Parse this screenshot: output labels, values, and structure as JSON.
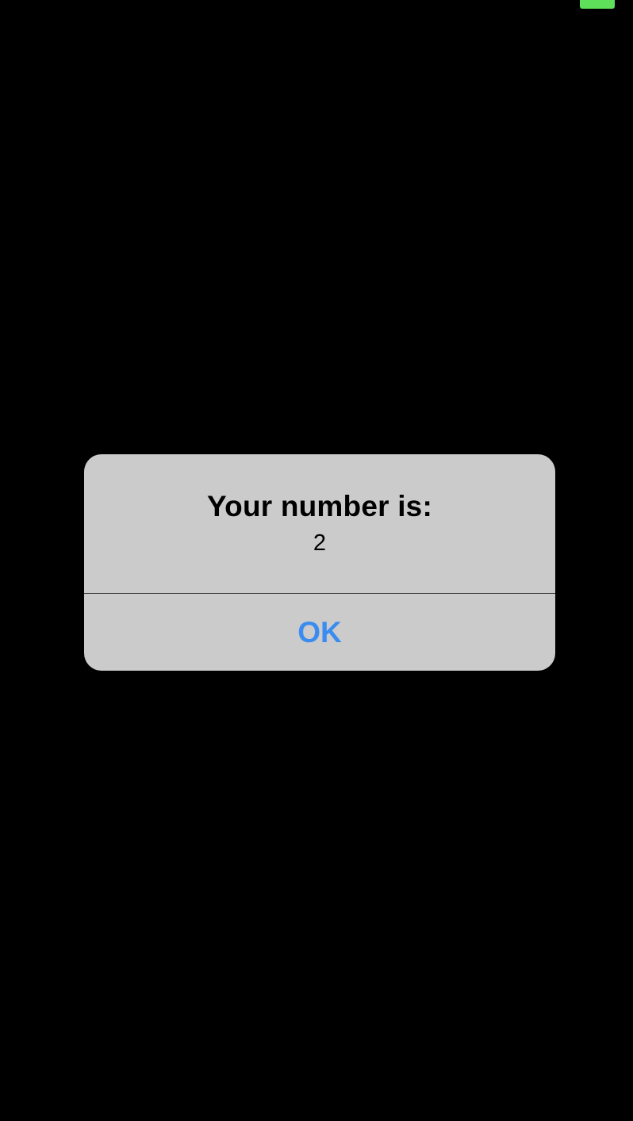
{
  "status_bar": {
    "indicator_color": "#5ee05a"
  },
  "alert": {
    "title": "Your number is:",
    "message": "2",
    "ok_label": "OK",
    "button_color": "#3a8cf0",
    "background_color": "#cbcbcb"
  }
}
